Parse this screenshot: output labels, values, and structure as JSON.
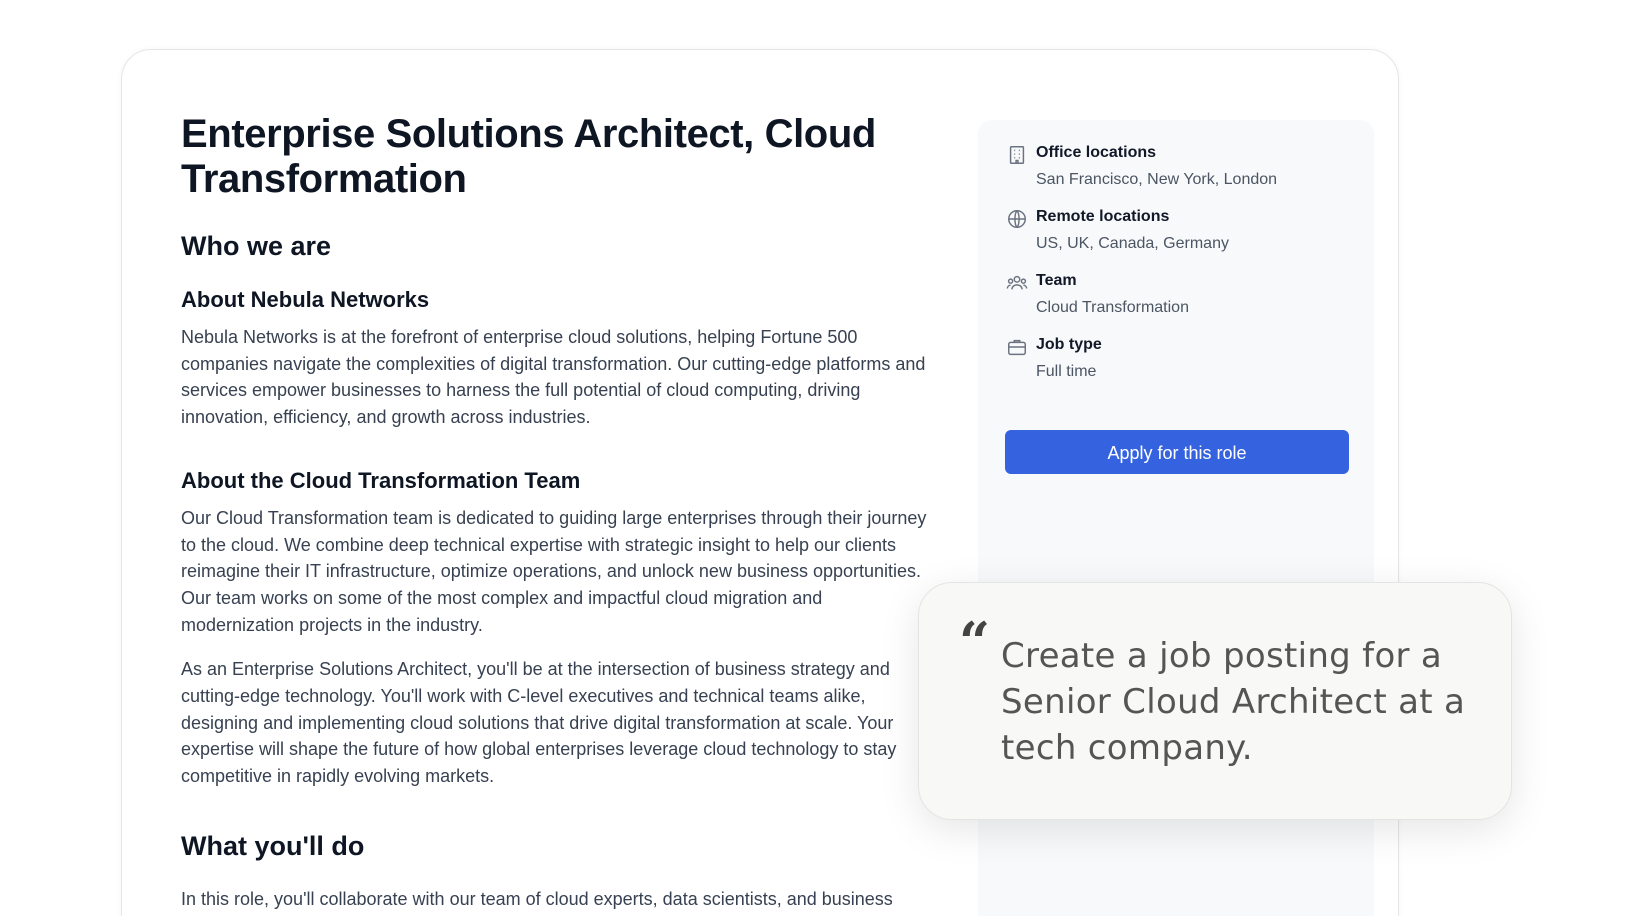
{
  "job": {
    "title": "Enterprise Solutions Architect, Cloud Transformation",
    "sections": {
      "who_we_are": "Who we are",
      "about_company_heading": "About Nebula Networks",
      "about_company_text": "Nebula Networks is at the forefront of enterprise cloud solutions, helping Fortune 500 companies navigate the complexities of digital transformation. Our cutting-edge platforms and services empower businesses to harness the full potential of cloud computing, driving innovation, efficiency, and growth across industries.",
      "about_team_heading": "About the Cloud Transformation Team",
      "about_team_text": "Our Cloud Transformation team is dedicated to guiding large enterprises through their journey to the cloud. We combine deep technical expertise with strategic insight to help our clients reimagine their IT infrastructure, optimize operations, and unlock new business opportunities. Our team works on some of the most complex and impactful cloud migration and modernization projects in the industry.",
      "role_text": "As an Enterprise Solutions Architect, you'll be at the intersection of business strategy and cutting-edge technology. You'll work with C-level executives and technical teams alike, designing and implementing cloud solutions that drive digital transformation at scale. Your expertise will shape the future of how global enterprises leverage cloud technology to stay competitive in rapidly evolving markets.",
      "what_youll_do": "What you'll do",
      "what_youll_do_text": "In this role, you'll collaborate with our team of cloud experts, data scientists, and business strategists to"
    }
  },
  "sidebar": {
    "office": {
      "label": "Office locations",
      "value": "San Francisco, New York, London",
      "icon": "building-icon"
    },
    "remote": {
      "label": "Remote locations",
      "value": "US, UK, Canada, Germany",
      "icon": "globe-icon"
    },
    "team": {
      "label": "Team",
      "value": "Cloud Transformation",
      "icon": "people-icon"
    },
    "job_type": {
      "label": "Job type",
      "value": "Full time",
      "icon": "briefcase-icon"
    },
    "apply_label": "Apply for this role"
  },
  "prompt": {
    "quote_mark": "“",
    "text": "Create a job posting for a Senior Cloud Architect at a tech company."
  },
  "colors": {
    "accent": "#3563e0",
    "sidebar_bg": "#f8f9fb",
    "heading": "#0f1623",
    "body_text": "#374151"
  }
}
